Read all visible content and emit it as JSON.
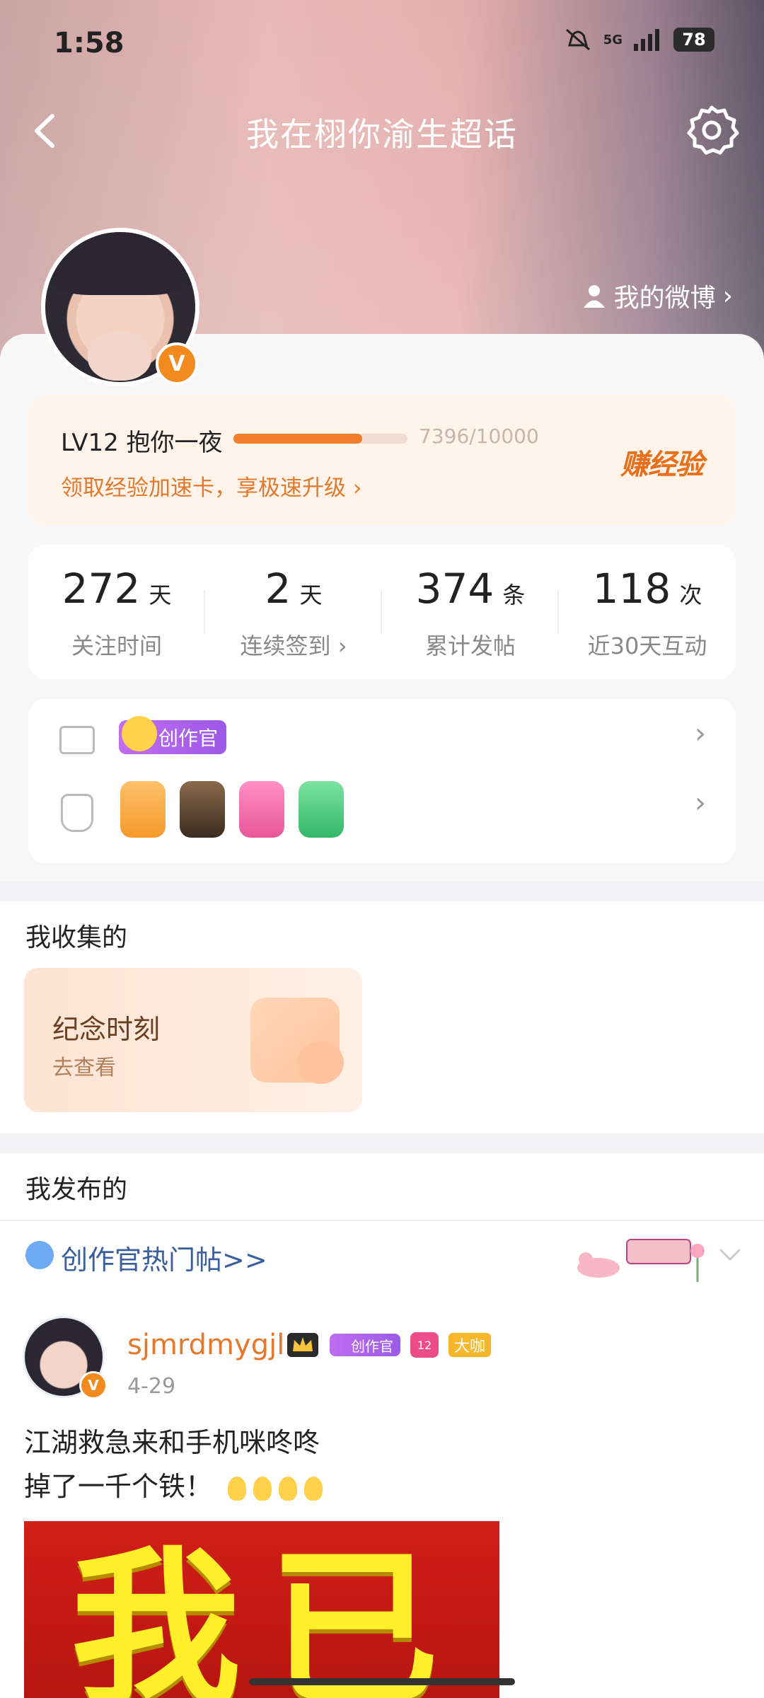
{
  "status_bar": {
    "time": "1:58",
    "network": "5G",
    "battery": "78"
  },
  "nav": {
    "title": "我在栩你渝生超话"
  },
  "header": {
    "my_weibo": "我的微博"
  },
  "level_card": {
    "level_text": "LV12 抱你一夜",
    "progress_text": "7396/10000",
    "progress_fraction": 0.7396,
    "tip": "领取经验加速卡，享极速升级",
    "earn_label": "赚经验"
  },
  "stats": [
    {
      "value": "272",
      "unit": "天",
      "label": "关注时间"
    },
    {
      "value": "2",
      "unit": "天",
      "label": "连续签到"
    },
    {
      "value": "374",
      "unit": "条",
      "label": "累计发帖"
    },
    {
      "value": "118",
      "unit": "次",
      "label": "近30天互动"
    }
  ],
  "badges": {
    "creator_chip": "创作官",
    "medals": [
      "crown-medal",
      "super-medal",
      "lv12-medal",
      "hand-medal"
    ]
  },
  "collected": {
    "title": "我收集的",
    "card_title": "纪念时刻",
    "card_sub": "去查看"
  },
  "published": {
    "title": "我发布的",
    "hot_link": "创作官热门帖>>"
  },
  "post": {
    "username": "sjmrdmygjl",
    "creator_tag": "创作官",
    "level_tag": "12",
    "big_tag": "大咖",
    "date": "4-29",
    "line1": "江湖救急来和手机咪咚咚",
    "line2": "掉了一千个铁！",
    "image_text": "我已"
  }
}
